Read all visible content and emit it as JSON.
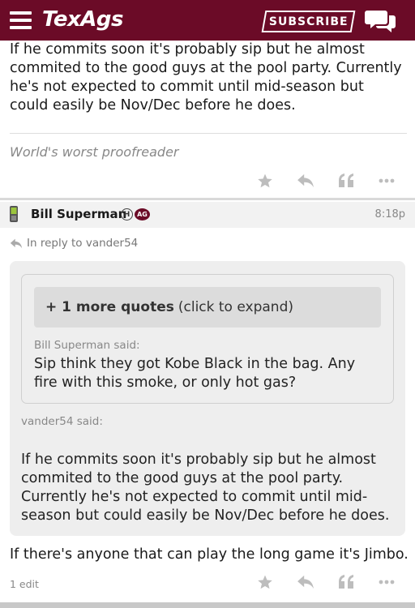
{
  "header": {
    "logo": "TexAgs",
    "subscribe_label": "SUBSCRIBE",
    "brand_color": "#6b0b27"
  },
  "previous_post": {
    "body": "If he commits soon it's probably sip but he almost commited to the good guys at the pool party. Currently he's not expected to commit until mid-season but could easily be Nov/Dec before he does.",
    "signature": "World's worst proofreader"
  },
  "post": {
    "author": "Bill Superman",
    "badges": [
      "H",
      "AG"
    ],
    "time": "8:18p",
    "in_reply_to": "In reply to vander54",
    "quote": {
      "more_quotes_bold": "+ 1 more quotes",
      "more_quotes_rest": "(click to expand)",
      "nested_author_said": "Bill Superman said:",
      "nested_text": "Sip think they got Kobe Black in the bag. Any fire with this smoke, or only hot gas?",
      "outer_author_said": "vander54 said:",
      "outer_text": "If he commits soon it's probably sip but he almost commited to the good guys at the pool party. Currently he's not expected to commit until mid-season but could easily be Nov/Dec before he does."
    },
    "body": "If there's anyone that can play the long game it's Jimbo.",
    "edit_count": "1 edit"
  },
  "actions": {
    "icons": [
      "star-icon",
      "reply-icon",
      "quote-icon",
      "more-icon"
    ]
  }
}
